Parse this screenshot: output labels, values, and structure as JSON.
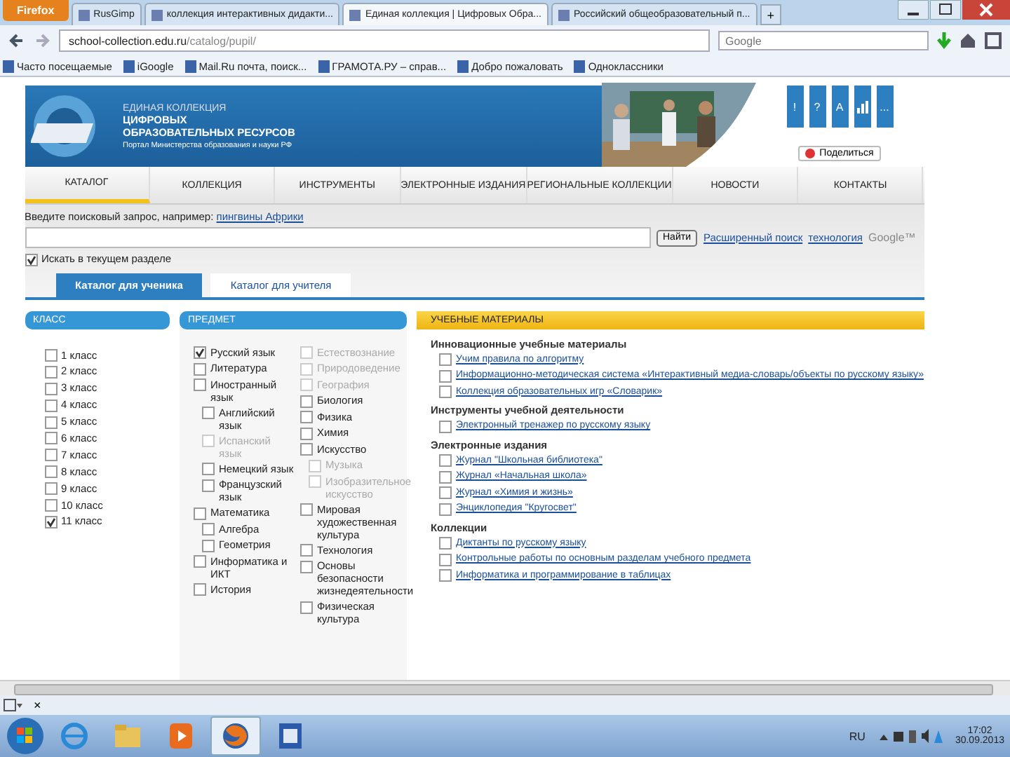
{
  "browser": {
    "menu_button": "Firefox",
    "tabs": [
      {
        "title": "RusGimp",
        "selected": false
      },
      {
        "title": "коллекция интерактивных дидакти...",
        "selected": false
      },
      {
        "title": "Единая коллекция | Цифровых Обра...",
        "selected": true
      },
      {
        "title": "Российский общеобразовательный п...",
        "selected": false
      }
    ],
    "new_tab": "+",
    "url_host": "school-collection.edu.ru",
    "url_path": "/catalog/pupil/",
    "search_placeholder": "Google",
    "bookmarks": [
      "Часто посещаемые",
      "iGoogle",
      "Mail.Ru почта, поиск...",
      "ГРАМОТА.РУ – справ...",
      "Добро пожаловать",
      "Одноклассники"
    ]
  },
  "header": {
    "title_lines": [
      "ЕДИНАЯ КОЛЛЕКЦИЯ",
      "ЦИФРОВЫХ",
      "ОБРАЗОВАТЕЛЬНЫХ РЕСУРСОВ"
    ],
    "subtitle": "Портал Министерства образования и науки РФ",
    "tools": [
      {
        "kind": "glyph",
        "text": "!"
      },
      {
        "kind": "glyph",
        "text": "?"
      },
      {
        "kind": "glyph",
        "text": "A"
      },
      {
        "kind": "bars"
      },
      {
        "kind": "glyph",
        "text": "..."
      }
    ],
    "share": "Поделиться"
  },
  "menu": [
    {
      "label": "КАТАЛОГ",
      "selected": true
    },
    {
      "label": "КОЛЛЕКЦИЯ",
      "selected": false
    },
    {
      "label": "ИНСТРУМЕНТЫ",
      "selected": false
    },
    {
      "label": "ЭЛЕКТРОННЫЕ ИЗДАНИЯ",
      "selected": false
    },
    {
      "label": "РЕГИОНАЛЬНЫЕ КОЛЛЕКЦИИ",
      "selected": false
    },
    {
      "label": "НОВОСТИ",
      "selected": false
    },
    {
      "label": "КОНТАКТЫ",
      "selected": false
    }
  ],
  "search": {
    "hint": "Введите поисковый запрос, например:",
    "example": "пингвины Африки",
    "button": "Найти",
    "advanced": "Расширенный поиск",
    "powered_link": "технология",
    "powered": "Google™",
    "scope": {
      "label": "Искать в текущем разделе",
      "checked": true
    }
  },
  "catalog_tabs": [
    {
      "label": "Каталог для ученика",
      "selected": true
    },
    {
      "label": "Каталог для учителя",
      "selected": false
    }
  ],
  "classes": {
    "title": "КЛАСС",
    "items": [
      {
        "label": "1 класс",
        "checked": false
      },
      {
        "label": "2 класс",
        "checked": false
      },
      {
        "label": "3 класс",
        "checked": false
      },
      {
        "label": "4 класс",
        "checked": false
      },
      {
        "label": "5 класс",
        "checked": false
      },
      {
        "label": "6 класс",
        "checked": false
      },
      {
        "label": "7 класс",
        "checked": false
      },
      {
        "label": "8 класс",
        "checked": false
      },
      {
        "label": "9 класс",
        "checked": false
      },
      {
        "label": "10 класс",
        "checked": false
      },
      {
        "label": "11 класс",
        "checked": true
      }
    ]
  },
  "subjects": {
    "title": "ПРЕДМЕТ",
    "columns": [
      [
        {
          "label": "Русский язык",
          "checked": true,
          "disabled": false
        },
        {
          "label": "Литература",
          "checked": false,
          "disabled": false
        },
        {
          "label": "Иностранный язык",
          "checked": false,
          "disabled": false,
          "children": [
            {
              "label": "Английский язык",
              "checked": false,
              "disabled": false
            },
            {
              "label": "Испанский язык",
              "checked": false,
              "disabled": true
            },
            {
              "label": "Немецкий язык",
              "checked": false,
              "disabled": false
            },
            {
              "label": "Французский язык",
              "checked": false,
              "disabled": false
            }
          ]
        },
        {
          "label": "Математика",
          "checked": false,
          "disabled": false,
          "children": [
            {
              "label": "Алгебра",
              "checked": false,
              "disabled": false
            },
            {
              "label": "Геометрия",
              "checked": false,
              "disabled": false
            }
          ]
        },
        {
          "label": "Информатика и ИКТ",
          "checked": false,
          "disabled": false
        },
        {
          "label": "История",
          "checked": false,
          "disabled": false
        }
      ],
      [
        {
          "label": "Естествознание",
          "checked": false,
          "disabled": true
        },
        {
          "label": "Природоведение",
          "checked": false,
          "disabled": true
        },
        {
          "label": "География",
          "checked": false,
          "disabled": true
        },
        {
          "label": "Биология",
          "checked": false,
          "disabled": false
        },
        {
          "label": "Физика",
          "checked": false,
          "disabled": false
        },
        {
          "label": "Химия",
          "checked": false,
          "disabled": false
        },
        {
          "label": "Искусство",
          "checked": false,
          "disabled": false,
          "children": [
            {
              "label": "Музыка",
              "checked": false,
              "disabled": true
            },
            {
              "label": "Изобразительное искусство",
              "checked": false,
              "disabled": true
            }
          ]
        },
        {
          "label": "Мировая художественная культура",
          "checked": false,
          "disabled": false
        },
        {
          "label": "Технология",
          "checked": false,
          "disabled": false
        },
        {
          "label": "Основы безопасности жизнедеятельности",
          "checked": false,
          "disabled": false
        },
        {
          "label": "Физическая культура",
          "checked": false,
          "disabled": false
        }
      ]
    ]
  },
  "materials": {
    "title": "УЧЕБНЫЕ МАТЕРИАЛЫ",
    "sections": [
      {
        "title": "Инновационные учебные материалы",
        "items": [
          {
            "text": "Учим правила по алгоритму",
            "checked": false
          },
          {
            "text": "Информационно-методическая система «Интерактивный медиа-словарь/объекты по русскому языку»",
            "checked": false
          },
          {
            "text": "Коллекция образовательных игр «Словарик»",
            "checked": false
          }
        ]
      },
      {
        "title": "Инструменты учебной деятельности",
        "items": [
          {
            "text": "Электронный тренажер по русскому языку",
            "checked": false
          }
        ]
      },
      {
        "title": "Электронные издания",
        "items": [
          {
            "text": "Журнал \"Школьная библиотека\"",
            "checked": false
          },
          {
            "text": "Журнал «Начальная школа»",
            "checked": false
          },
          {
            "text": "Журнал «Химия и жизнь»",
            "checked": false
          },
          {
            "text": "Энциклопедия \"Кругосвет\"",
            "checked": false
          }
        ]
      },
      {
        "title": "Коллекции",
        "items": [
          {
            "text": "Диктанты по русскому языку",
            "checked": false
          },
          {
            "text": "Контрольные работы по основным разделам учебного предмета",
            "checked": false
          },
          {
            "text": "Информатика и программирование в таблицах",
            "checked": false
          }
        ]
      }
    ]
  },
  "findbar": {
    "close": "×"
  },
  "taskbar": {
    "apps": [
      {
        "kind": "ie",
        "selected": false
      },
      {
        "kind": "folder",
        "selected": false
      },
      {
        "kind": "media",
        "selected": false
      },
      {
        "kind": "firefox",
        "selected": true
      },
      {
        "kind": "word",
        "selected": false
      }
    ],
    "language": "RU",
    "time": "17:02",
    "date": "30.09.2013"
  }
}
